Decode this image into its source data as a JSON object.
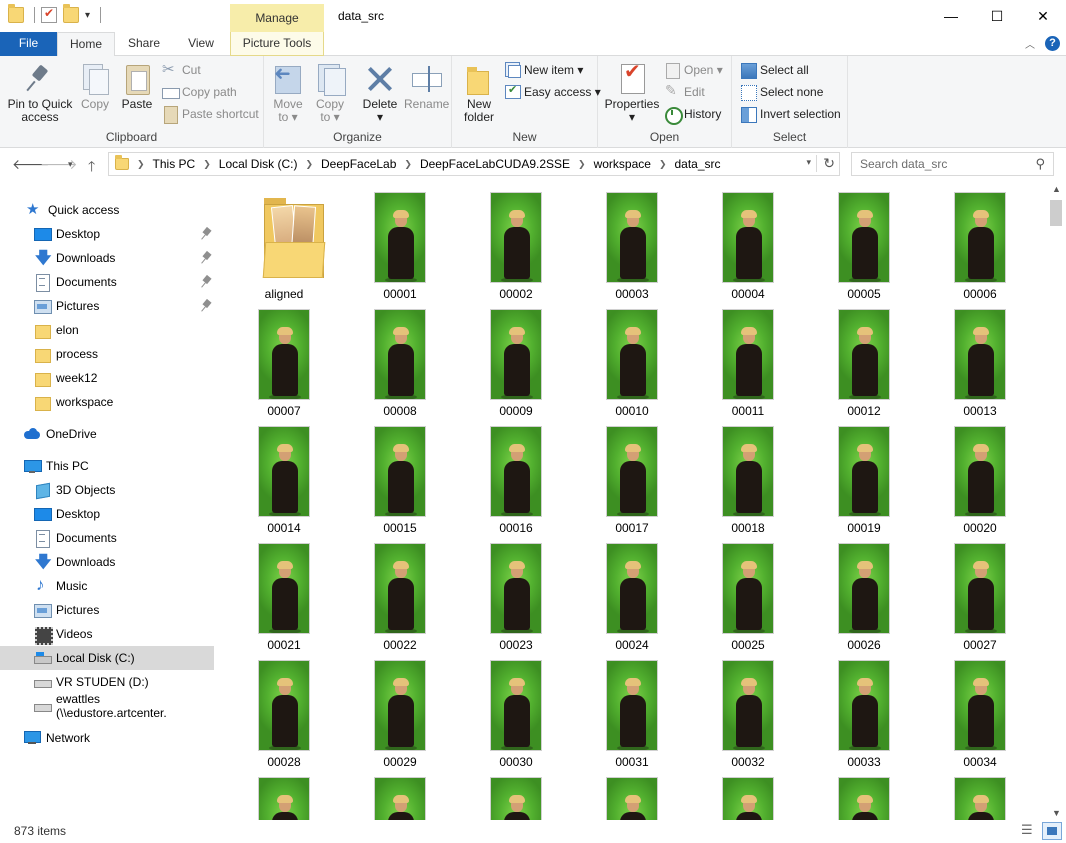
{
  "window": {
    "title": "data_src",
    "manage_label": "Manage",
    "minimize": "—",
    "maximize": "☐",
    "close": "✕"
  },
  "ribbon_tabs": {
    "file": "File",
    "home": "Home",
    "share": "Share",
    "view": "View",
    "picture_tools": "Picture Tools"
  },
  "ribbon": {
    "clipboard": {
      "label": "Clipboard",
      "pin_line1": "Pin to Quick",
      "pin_line2": "access",
      "copy": "Copy",
      "paste": "Paste",
      "cut": "Cut",
      "copy_path": "Copy path",
      "paste_shortcut": "Paste shortcut"
    },
    "organize": {
      "label": "Organize",
      "move_to": "Move",
      "move_to_2": "to ▾",
      "copy_to": "Copy",
      "copy_to_2": "to ▾",
      "delete": "Delete",
      "delete_2": "▾",
      "rename": "Rename"
    },
    "new": {
      "label": "New",
      "new_folder": "New",
      "new_folder_2": "folder",
      "new_item": "New item ▾",
      "easy_access": "Easy access ▾"
    },
    "open": {
      "label": "Open",
      "properties": "Properties",
      "properties_2": "▾",
      "open": "Open ▾",
      "edit": "Edit",
      "history": "History"
    },
    "select": {
      "label": "Select",
      "select_all": "Select all",
      "select_none": "Select none",
      "invert_selection": "Invert selection"
    }
  },
  "address": {
    "crumbs": [
      "This PC",
      "Local Disk (C:)",
      "DeepFaceLab",
      "DeepFaceLabCUDA9.2SSE",
      "workspace",
      "data_src"
    ],
    "search_placeholder": "Search data_src"
  },
  "nav": {
    "quick_access": "Quick access",
    "qa_items": [
      "Desktop",
      "Downloads",
      "Documents",
      "Pictures",
      "elon",
      "process",
      "week12",
      "workspace"
    ],
    "onedrive": "OneDrive",
    "this_pc": "This PC",
    "pc_items": [
      "3D Objects",
      "Desktop",
      "Documents",
      "Downloads",
      "Music",
      "Pictures",
      "Videos",
      "Local Disk (C:)",
      "VR STUDEN (D:)",
      "ewattles (\\\\edustore.artcenter."
    ],
    "network": "Network"
  },
  "files": {
    "folder_name": "aligned",
    "image_names": [
      "00001",
      "00002",
      "00003",
      "00004",
      "00005",
      "00006",
      "00007",
      "00008",
      "00009",
      "00010",
      "00011",
      "00012",
      "00013",
      "00014",
      "00015",
      "00016",
      "00017",
      "00018",
      "00019",
      "00020",
      "00021",
      "00022",
      "00023",
      "00024",
      "00025",
      "00026",
      "00027",
      "00028",
      "00029",
      "00030",
      "00031",
      "00032",
      "00033",
      "00034",
      "",
      "",
      "",
      "",
      "",
      "",
      ""
    ]
  },
  "status": {
    "item_count": "873 items"
  },
  "colors": {
    "file_tab": "#1a64b8",
    "manage_tab": "#f7edaa",
    "selected_nav": "#d9d9d9"
  }
}
